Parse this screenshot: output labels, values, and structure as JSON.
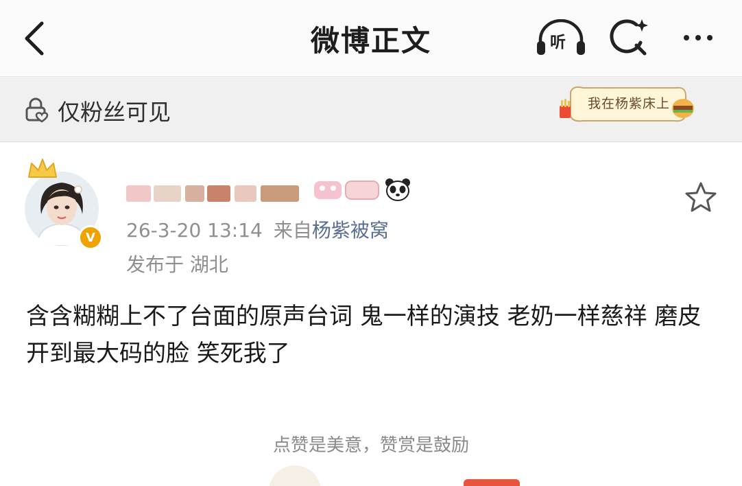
{
  "nav": {
    "title": "微博正文",
    "listen_label": "听",
    "icons": {
      "back": "back-arrow-icon",
      "listen": "headphones-listen-icon",
      "search": "search-sparkle-icon",
      "more": "more-dots-icon"
    }
  },
  "visibility": {
    "label": "仅粉丝可见",
    "icon": "lock-heart-icon",
    "card_badge_text": "我在杨紫床上"
  },
  "post": {
    "author": {
      "avatar": "avatar",
      "crown_icon": "crown-icon",
      "verified_badge": "V",
      "badges": [
        "member-badge",
        "panda-icon"
      ]
    },
    "time": "26-3-20 13:14",
    "source_prefix": "来自",
    "source_name": "杨紫被窝",
    "location": "发布于 湖北",
    "text": "含含糊糊上不了台面的原声台词 鬼一样的演技 老奶一样慈祥 磨皮开到最大码的脸 笑死我了",
    "favorite_icon": "star-outline-icon"
  },
  "reward": {
    "hint": "点赞是美意，赞赏是鼓励"
  },
  "colors": {
    "verified": "#f0a300",
    "source_link": "#5a6f90",
    "meta": "#8f8f8f"
  }
}
